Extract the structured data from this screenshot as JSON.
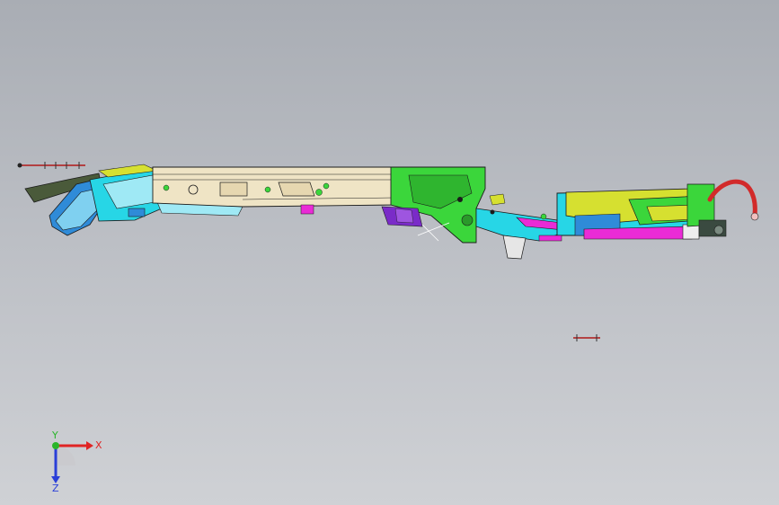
{
  "viewport": {
    "background_top": "#a9adb4",
    "background_bottom": "#cfd1d5"
  },
  "model": {
    "parts": [
      "boom-main-section",
      "boom-head",
      "green-hinge-bracket",
      "cab-chassis",
      "red-hose"
    ],
    "colors": {
      "main_section": "#efe4c5",
      "green": "#3bd63b",
      "cyan": "#27d6e6",
      "blue": "#2f8bd8",
      "magenta": "#ea2bd6",
      "purple": "#7a2bc8",
      "yellow": "#d6e030",
      "red_hose": "#d22a2a",
      "outline": "#1b1b1b"
    }
  },
  "triad": {
    "x_label": "X",
    "y_label": "Y",
    "z_label": "Z",
    "x_color": "#e02424",
    "y_color": "#2ab52a",
    "z_color": "#2a3fd8"
  }
}
